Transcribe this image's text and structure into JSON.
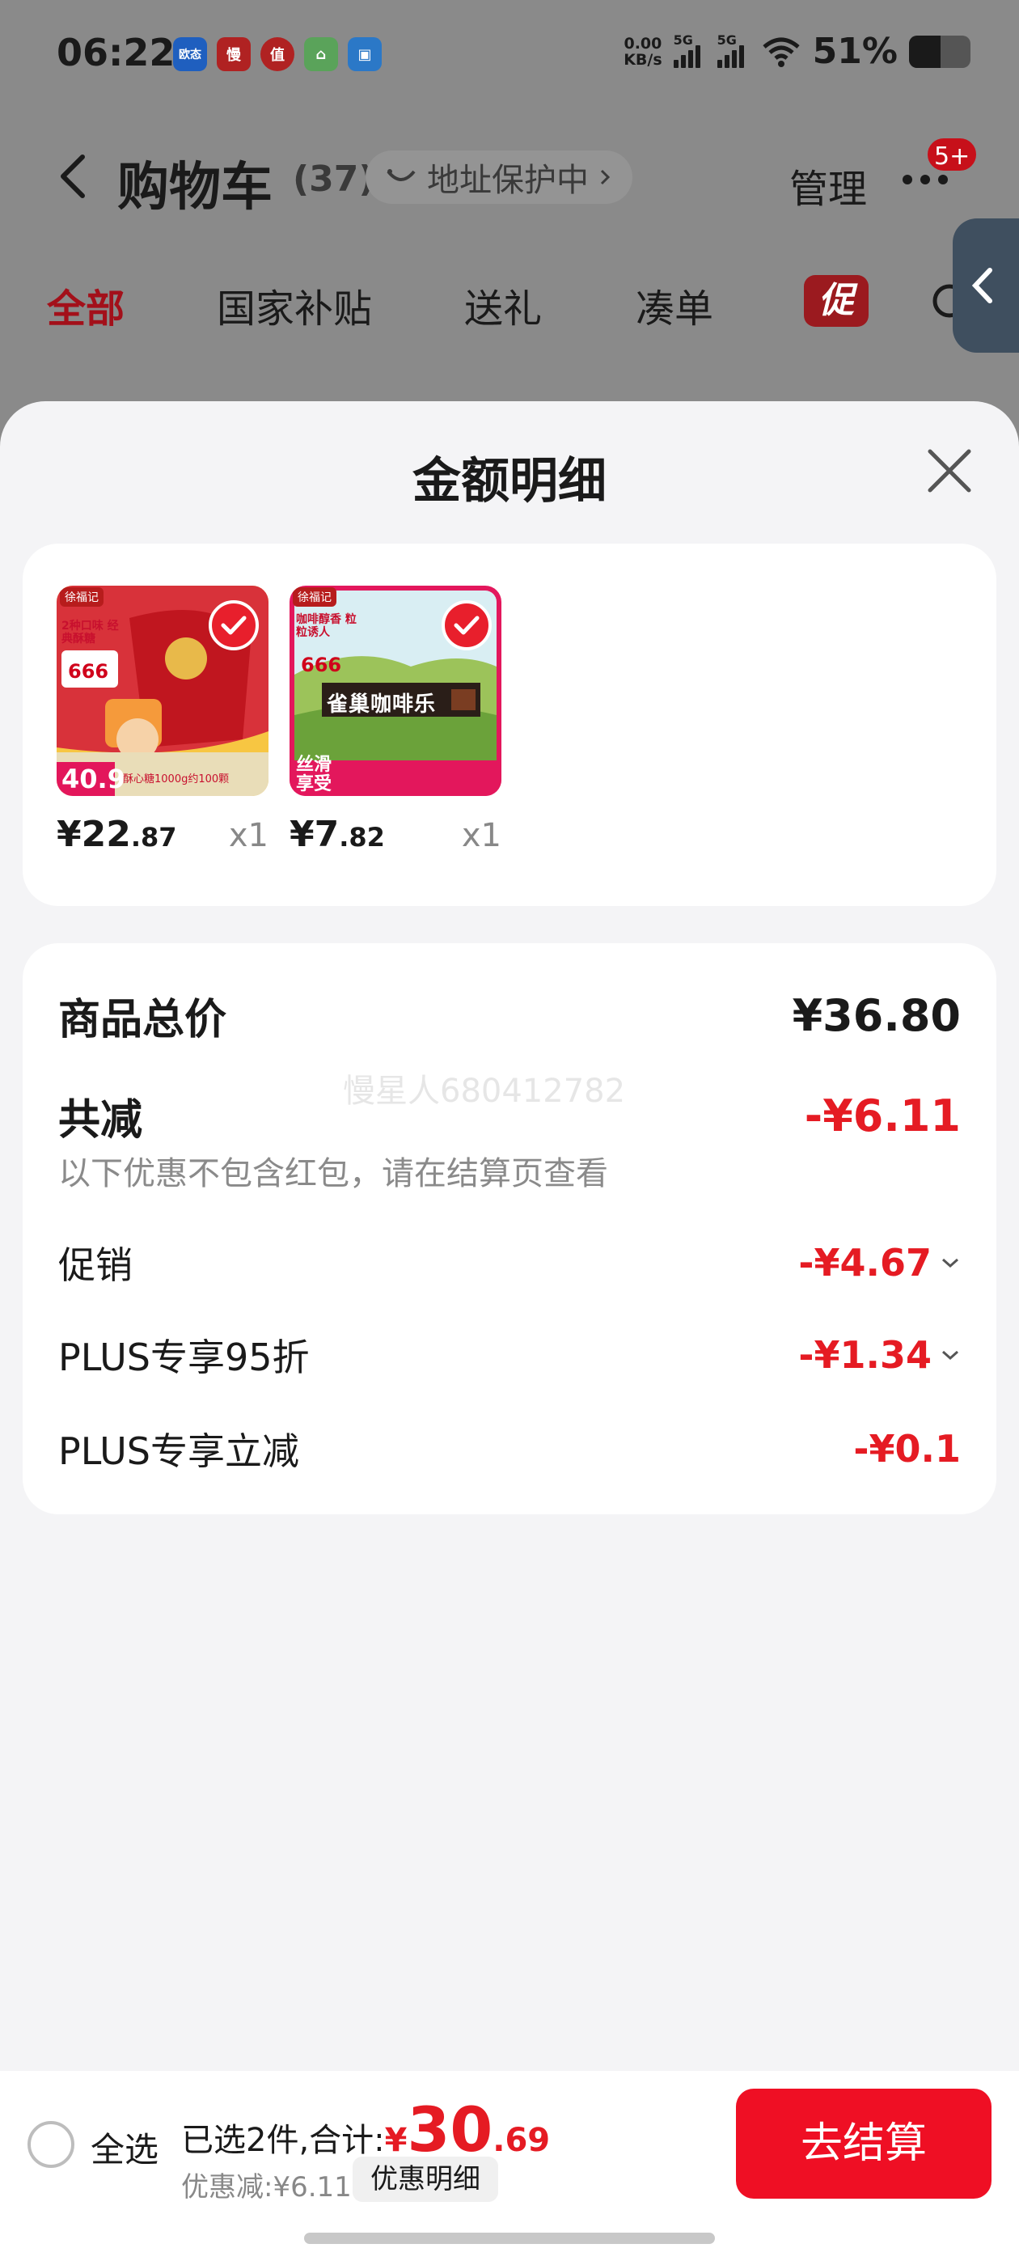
{
  "status_bar": {
    "time": "06:22",
    "app_icons": [
      {
        "label": "欧态",
        "color": "#1f5fbf",
        "icon": "app-icon-blue"
      },
      {
        "label": "慢",
        "color": "#b02222",
        "icon": "app-icon-red"
      },
      {
        "label": "值",
        "color": "#b02222",
        "icon": "app-icon-red-circle"
      },
      {
        "label": "⌂",
        "color": "#5aa35a",
        "icon": "app-icon-home"
      },
      {
        "label": "▣",
        "color": "#2b78c7",
        "icon": "app-icon-chat"
      }
    ],
    "net_speed_value": "0.00",
    "net_speed_unit": "KB/s",
    "signal_1": "5G",
    "signal_2": "5G",
    "battery": "51%"
  },
  "nav": {
    "title": "购物车",
    "count": "(37)",
    "address_status": "地址保护中",
    "manage": "管理",
    "badge": "5+"
  },
  "tabs": [
    {
      "label": "全部",
      "active": true
    },
    {
      "label": "国家补贴",
      "active": false
    },
    {
      "label": "送礼",
      "active": false
    },
    {
      "label": "凑单",
      "active": false
    }
  ],
  "promo_tab": "促",
  "sheet": {
    "title": "金额明细",
    "products": [
      {
        "price_int": "¥22",
        "price_dec": ".87",
        "qty": "x1",
        "image_texts": {
          "brand": "徐福记",
          "top": "2种口味 经典酥糖",
          "num": "666",
          "price_tag": "40.9",
          "caption": "酥心糖1000g约100颗"
        }
      },
      {
        "price_int": "¥7",
        "price_dec": ".82",
        "qty": "x1",
        "image_texts": {
          "brand": "徐福记",
          "top": "咖啡醇香 粒粒诱人",
          "num": "666",
          "banner": "雀巢咖啡乐",
          "side": "丝滑享受"
        }
      }
    ],
    "totals": {
      "goods_total_label": "商品总价",
      "goods_total_value": "¥36.80",
      "reduction_label": "共减",
      "reduction_value": "-¥6.11",
      "note": "以下优惠不包含红包，请在结算页查看",
      "watermark": "慢星人680412782",
      "items": [
        {
          "label": "促销",
          "value": "-¥4.67",
          "expandable": true
        },
        {
          "label": "PLUS专享95折",
          "value": "-¥1.34",
          "expandable": true
        },
        {
          "label": "PLUS专享立减",
          "value": "-¥0.1",
          "expandable": false
        }
      ]
    }
  },
  "bottom_bar": {
    "select_all": "全选",
    "selected_prefix": "已选2件,合计:",
    "total_yen": "¥",
    "total_int": "30",
    "total_dec": ".69",
    "discount_text": "优惠减:¥6.11",
    "discount_detail_button": "优惠明细",
    "checkout_button": "去结算"
  },
  "colors": {
    "accent_red": "#e51b23",
    "checkout_red": "#ef0f24"
  }
}
